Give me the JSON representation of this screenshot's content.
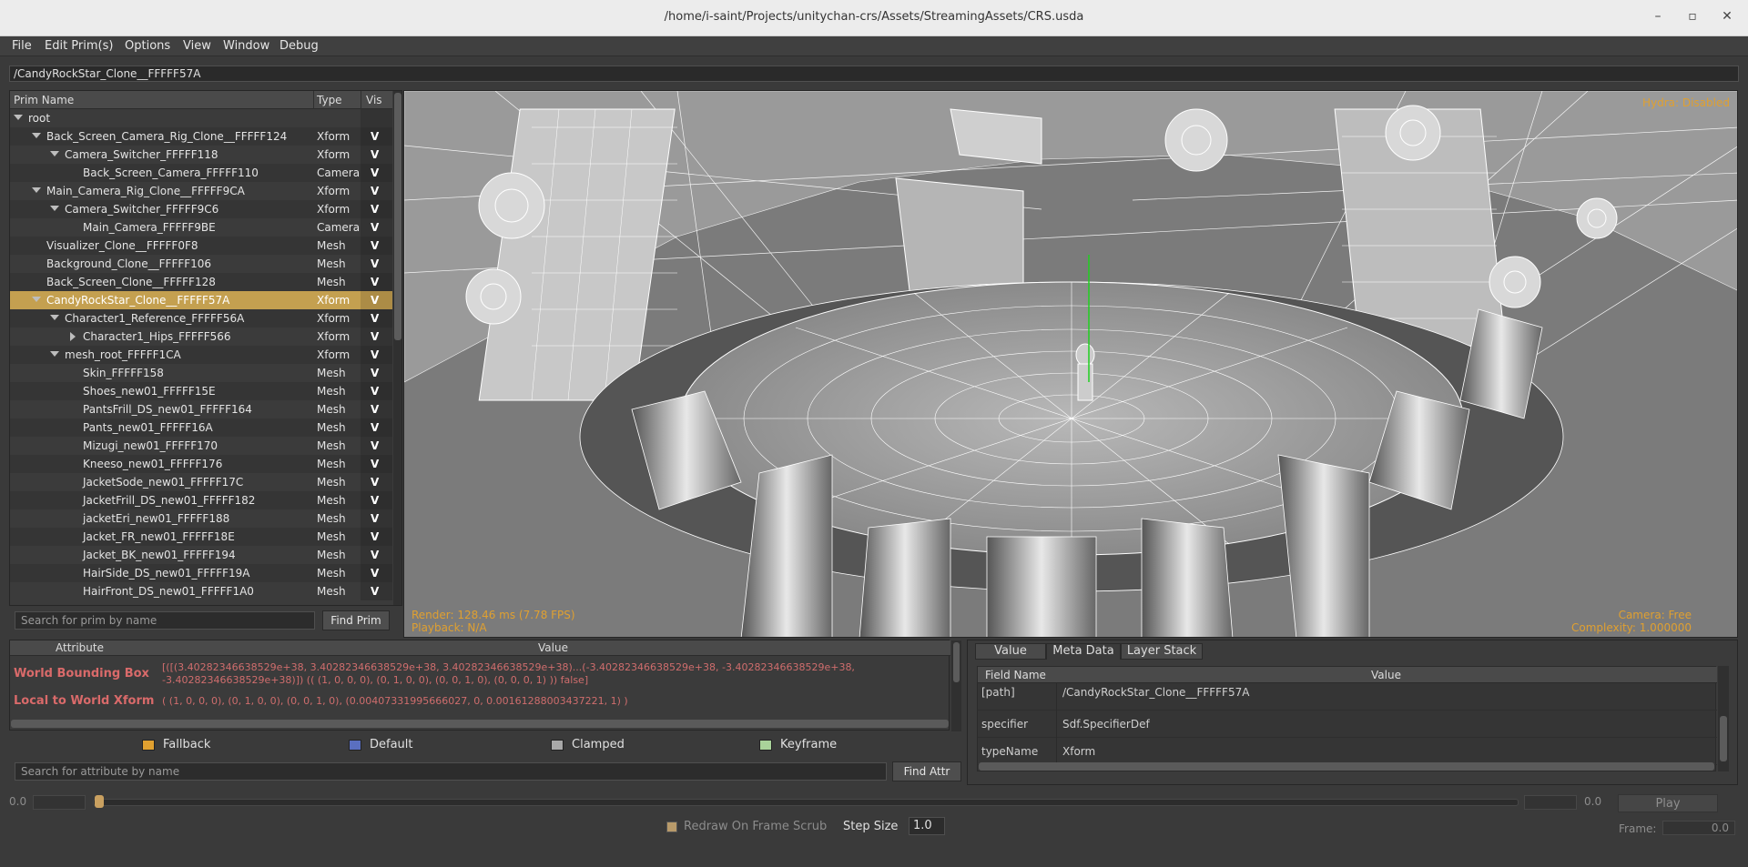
{
  "window": {
    "title": "/home/i-saint/Projects/unitychan-crs/Assets/StreamingAssets/CRS.usda",
    "minimize": "–",
    "maximize": "▫",
    "close": "✕"
  },
  "menu": {
    "file": "File",
    "edit": "Edit Prim(s)",
    "options": "Options",
    "view": "View",
    "window": "Window",
    "debug": "Debug"
  },
  "path": "/CandyRockStar_Clone__FFFFF57A",
  "tree": {
    "headers": {
      "name": "Prim Name",
      "type": "Type",
      "vis": "Vis"
    },
    "rows": [
      {
        "name": "root",
        "type": "",
        "vis": ""
      },
      {
        "name": "Back_Screen_Camera_Rig_Clone__FFFFF124",
        "type": "Xform",
        "vis": "V"
      },
      {
        "name": "Camera_Switcher_FFFFF118",
        "type": "Xform",
        "vis": "V"
      },
      {
        "name": "Back_Screen_Camera_FFFFF110",
        "type": "Camera",
        "vis": "V"
      },
      {
        "name": "Main_Camera_Rig_Clone__FFFFF9CA",
        "type": "Xform",
        "vis": "V"
      },
      {
        "name": "Camera_Switcher_FFFFF9C6",
        "type": "Xform",
        "vis": "V"
      },
      {
        "name": "Main_Camera_FFFFF9BE",
        "type": "Camera",
        "vis": "V"
      },
      {
        "name": "Visualizer_Clone__FFFFF0F8",
        "type": "Mesh",
        "vis": "V"
      },
      {
        "name": "Background_Clone__FFFFF106",
        "type": "Mesh",
        "vis": "V"
      },
      {
        "name": "Back_Screen_Clone__FFFFF128",
        "type": "Mesh",
        "vis": "V"
      },
      {
        "name": "CandyRockStar_Clone__FFFFF57A",
        "type": "Xform",
        "vis": "V"
      },
      {
        "name": "Character1_Reference_FFFFF56A",
        "type": "Xform",
        "vis": "V"
      },
      {
        "name": "Character1_Hips_FFFFF566",
        "type": "Xform",
        "vis": "V"
      },
      {
        "name": "mesh_root_FFFFF1CA",
        "type": "Xform",
        "vis": "V"
      },
      {
        "name": "Skin_FFFFF158",
        "type": "Mesh",
        "vis": "V"
      },
      {
        "name": "Shoes_new01_FFFFF15E",
        "type": "Mesh",
        "vis": "V"
      },
      {
        "name": "PantsFrill_DS_new01_FFFFF164",
        "type": "Mesh",
        "vis": "V"
      },
      {
        "name": "Pants_new01_FFFFF16A",
        "type": "Mesh",
        "vis": "V"
      },
      {
        "name": "Mizugi_new01_FFFFF170",
        "type": "Mesh",
        "vis": "V"
      },
      {
        "name": "Kneeso_new01_FFFFF176",
        "type": "Mesh",
        "vis": "V"
      },
      {
        "name": "JacketSode_new01_FFFFF17C",
        "type": "Mesh",
        "vis": "V"
      },
      {
        "name": "JacketFrill_DS_new01_FFFFF182",
        "type": "Mesh",
        "vis": "V"
      },
      {
        "name": "jacketEri_new01_FFFFF188",
        "type": "Mesh",
        "vis": "V"
      },
      {
        "name": "Jacket_FR_new01_FFFFF18E",
        "type": "Mesh",
        "vis": "V"
      },
      {
        "name": "Jacket_BK_new01_FFFFF194",
        "type": "Mesh",
        "vis": "V"
      },
      {
        "name": "HairSide_DS_new01_FFFFF19A",
        "type": "Mesh",
        "vis": "V"
      },
      {
        "name": "HairFront_DS_new01_FFFFF1A0",
        "type": "Mesh",
        "vis": "V"
      }
    ],
    "search_placeholder": "Search for prim by name",
    "find_button": "Find Prim"
  },
  "viewport": {
    "hydra": "Hydra: Disabled",
    "render": "Render: 128.46 ms (7.78 FPS)",
    "playback": "Playback: N/A",
    "camera": "Camera: Free",
    "complexity": "Complexity: 1.000000"
  },
  "attributes": {
    "headers": {
      "attribute": "Attribute",
      "value": "Value"
    },
    "rows": [
      {
        "name": "World Bounding Box",
        "value": "[([(3.40282346638529e+38, 3.40282346638529e+38, 3.40282346638529e+38)...(-3.40282346638529e+38, -3.40282346638529e+38, -3.40282346638529e+38)]) (( (1, 0, 0, 0), (0, 1, 0, 0), (0, 0, 1, 0), (0, 0, 0, 1) )) false]"
      },
      {
        "name": "Local to World Xform",
        "value": "( (1, 0, 0, 0), (0, 1, 0, 0), (0, 0, 1, 0), (0.00407331995666027, 0, 0.00161288003437221, 1) )"
      }
    ],
    "legend": [
      {
        "label": "Fallback",
        "color": "#e0a030"
      },
      {
        "label": "Default",
        "color": "#5a6fc0"
      },
      {
        "label": "Clamped",
        "color": "#a8a8a8"
      },
      {
        "label": "Keyframe",
        "color": "#a9d39a"
      }
    ],
    "search_placeholder": "Search for attribute by name",
    "find_button": "Find Attr"
  },
  "metadata": {
    "tabs": [
      "Value",
      "Meta Data",
      "Layer Stack"
    ],
    "active_tab": "Meta Data",
    "headers": {
      "field": "Field Name",
      "value": "Value"
    },
    "rows": [
      {
        "field": "[path]",
        "value": "/CandyRockStar_Clone__FFFFF57A"
      },
      {
        "field": "specifier",
        "value": "Sdf.SpecifierDef"
      },
      {
        "field": "typeName",
        "value": "Xform"
      }
    ]
  },
  "timeline": {
    "start": "0.0",
    "end": "0.0",
    "play": "Play",
    "redraw": "Redraw On Frame Scrub",
    "step_label": "Step Size",
    "step_value": "1.0",
    "frame_label": "Frame:",
    "frame_value": "0.0"
  }
}
